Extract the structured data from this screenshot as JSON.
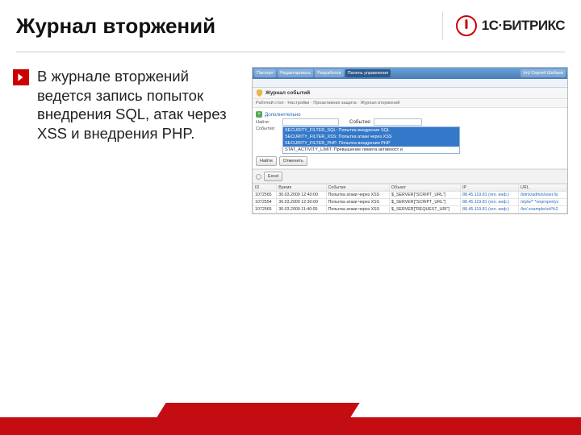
{
  "header": {
    "title": "Журнал вторжений",
    "brand": "1С·БИТРИКС"
  },
  "body_text": "В журнале вторжений ведется запись попыток внедрения SQL, атак через XSS и внедрения PHP.",
  "screenshot": {
    "top_tabs": [
      "Паспорт",
      "Редактировать",
      "Разработка",
      "Панель управления"
    ],
    "right_status": "(m) Сергей Шабаев",
    "journal_title": "Журнал событий",
    "breadcrumb": "Рабочий стол · Настройки · Проактивная защита · Журнал вторжений",
    "add_label": "Дополнительно",
    "filter": {
      "name_label": "Найти:",
      "event_label": "Событие:",
      "evt_label": "События:",
      "options": [
        "SECURITY_FILTER_SQL: Попытка внедрения SQL",
        "SECURITY_FILTER_XSS: Попытка атаки через XSS",
        "SECURITY_FILTER_PHP: Попытка внедрения PHP",
        "STAT_ACTIVITY_LIMIT: Превышение лимита активност и"
      ],
      "find": "Найти",
      "cancel": "Отменить"
    },
    "excel": "Excel",
    "cols": [
      "ID",
      "Время",
      "Событие",
      "Объект",
      "IP",
      "URL"
    ],
    "rows": [
      {
        "id": "1072565",
        "time": "30.03.2009 12:40:00",
        "evt": "Попытка атаки через XSS",
        "obj": "$_SERVER[\"SCRIPT_URL\"]",
        "ip": "88.45.119.81 (гео. инф.)",
        "url": "/bitrix/admin/user.lis"
      },
      {
        "id": "1072554",
        "time": "30.03.2009 12:30:00",
        "evt": "Попытка атаки через XSS",
        "obj": "$_SERVER[\"SCRIPT_URL\"]",
        "ip": "88.45.119.81 (гео. инф.)",
        "url": "/style/* *onpropertyc"
      },
      {
        "id": "1072565",
        "time": "30.03.2009 11:40:00",
        "evt": "Попытка атаки через XSS",
        "obj": "$_SERVER[\"REQUEST_URI\"]",
        "ip": "88.45.119.81 (гео. инф.)",
        "url": "/bx/ example/url/%2"
      }
    ]
  }
}
